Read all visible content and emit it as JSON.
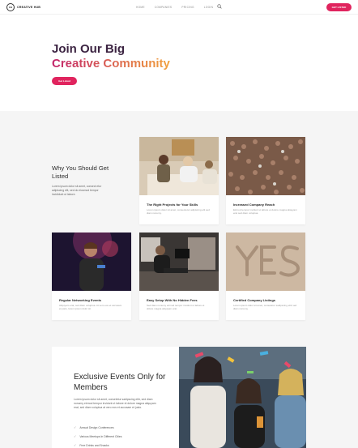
{
  "header": {
    "logo_mark": "CH",
    "logo_text": "CREATIVE HUB",
    "nav": [
      "HOME",
      "COMPANIES",
      "PRICING",
      "LOGIN"
    ],
    "cta": "GET LISTED"
  },
  "hero": {
    "title_line1": "Join Our Big",
    "title_line2": "Creative Community",
    "button": "Get Listed"
  },
  "why": {
    "title": "Why You Should Get Listed",
    "description": "Lorem ipsum dolor sit amet, consect etur adipiscing elit, sed do eiusmod tempor incididunt ut labore."
  },
  "cards": [
    {
      "title": "The Right Projects for Your Skills",
      "desc": "Lorem ipsum dolor sit amet, consectetur adipiscing elit sed diam nonumy."
    },
    {
      "title": "Increased Company Reach",
      "desc": "Eirmod tempor invidunt ut labore et dolore magna aliquyam erat sed diam voluptua."
    },
    {
      "title": "Regular Networking Events",
      "desc": "Aliquyam erat, sed diam voluptua. At vero eos et accusam et justo, lorem ipsum dolor sit."
    },
    {
      "title": "Easy Setup With No Hidden Fees",
      "desc": "Sed diam nonumy eirmod tempor invidunt ut labore et dolore magna aliquyam erat."
    },
    {
      "title": "Certified Company Listings",
      "desc": "Lorem ipsum dolor sit amet, consetetur sadipscing elitr sed diam nonumy."
    }
  ],
  "events": {
    "title": "Exclusive Events Only for Members",
    "description": "Lorem ipsum dolor sit amet, consetetur sadipscing elitr, sed diam nonumy eirmod tempor invidunt ut labore et dolore magna aliquyam erat, sed diam voluptua at vero eos et accusam et justo.",
    "items": [
      "Annual Design Conferences",
      "Various Meetups In Different Cities",
      "Free Drinks and Snacks"
    ]
  },
  "colors": {
    "accent": "#e0245e",
    "grad_start": "#c2246a",
    "grad_end": "#f2a23c",
    "section_bg": "#f5f5f5"
  }
}
